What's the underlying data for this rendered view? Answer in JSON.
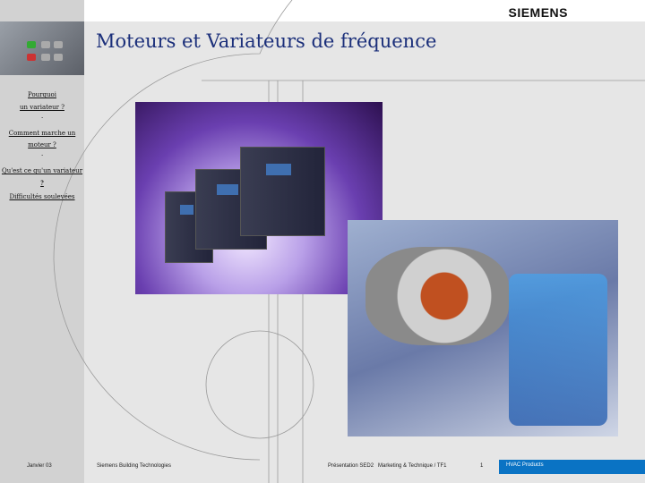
{
  "header": {
    "brand": "SIEMENS",
    "title": "Moteurs et Variateurs de fréquence"
  },
  "sidebar": {
    "items": [
      {
        "label": "Pourquoi"
      },
      {
        "label": "un variateur ?"
      },
      {
        "label": "Comment marche un"
      },
      {
        "label": "moteur ?"
      },
      {
        "label": "Qu'est ce qu'un variateur ?"
      },
      {
        "label": "Difficultés soulevées"
      }
    ],
    "separator": "·"
  },
  "footer": {
    "date": "Janvier 03",
    "company": "Siemens Building Technologies",
    "presentation": "Présentation SED2   Marketing & Technique / TF1",
    "page": "1",
    "division": "HVAC Products"
  },
  "colors": {
    "title": "#1b2f7a",
    "accent": "#0a73c4"
  }
}
